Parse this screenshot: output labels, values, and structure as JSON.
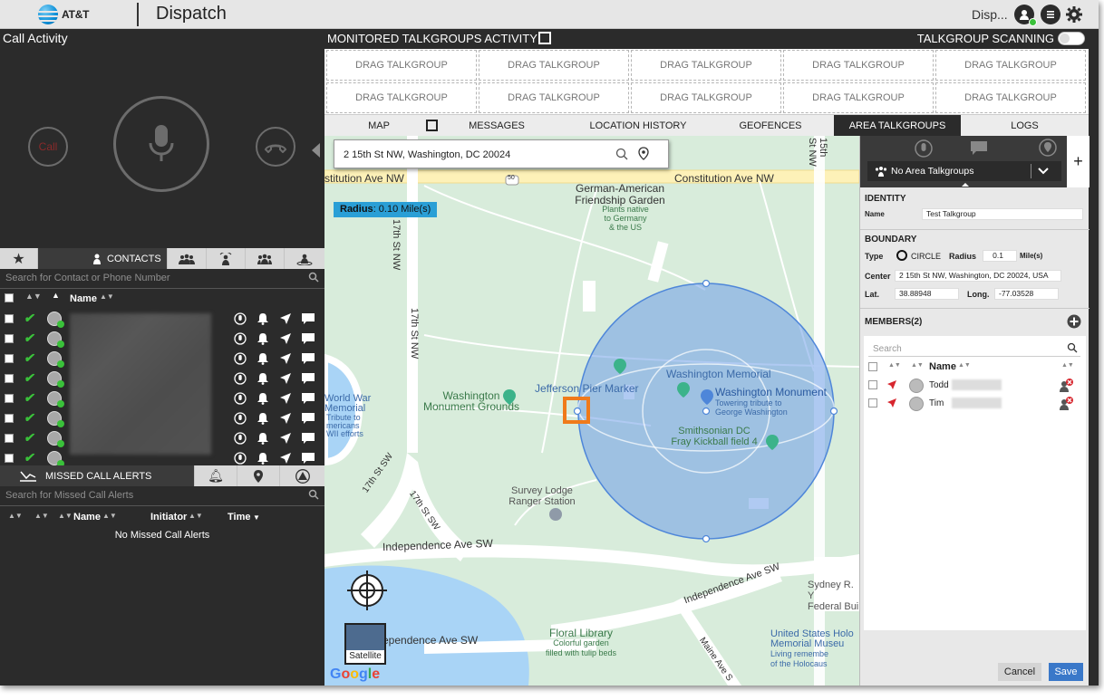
{
  "brand": {
    "logo_text": "AT&T",
    "app_title": "Dispatch",
    "user_label": "Disp..."
  },
  "call_activity": {
    "title": "Call Activity",
    "hold_label": "Call"
  },
  "contacts": {
    "tab_label": "CONTACTS",
    "search_placeholder": "Search for Contact or Phone Number",
    "column_name": "Name",
    "rows": [
      {
        "status": "online"
      },
      {
        "status": "online"
      },
      {
        "status": "online"
      },
      {
        "status": "online"
      },
      {
        "status": "online"
      },
      {
        "status": "online"
      },
      {
        "status": "online"
      },
      {
        "status": "online"
      }
    ]
  },
  "missed_alerts": {
    "tab_label": "MISSED CALL ALERTS",
    "search_placeholder": "Search for Missed Call Alerts",
    "col_name": "Name",
    "col_initiator": "Initiator",
    "col_time": "Time",
    "empty_text": "No Missed Call Alerts"
  },
  "monitored": {
    "title": "MONITORED TALKGROUPS ACTIVITY",
    "scanning_label": "TALKGROUP SCANNING",
    "scanning_on": false,
    "slots": [
      "DRAG TALKGROUP",
      "DRAG TALKGROUP",
      "DRAG TALKGROUP",
      "DRAG TALKGROUP",
      "DRAG TALKGROUP",
      "DRAG TALKGROUP",
      "DRAG TALKGROUP",
      "DRAG TALKGROUP",
      "DRAG TALKGROUP",
      "DRAG TALKGROUP"
    ]
  },
  "tabs": [
    "MAP",
    "MESSAGES",
    "LOCATION HISTORY",
    "GEOFENCES",
    "AREA TALKGROUPS",
    "LOGS"
  ],
  "active_tab": "AREA TALKGROUPS",
  "map": {
    "address": "2 15th St NW, Washington, DC 20024",
    "radius_label": "Radius",
    "radius_value": ": 0.10 Mile(s)",
    "satellite_label": "Satellite",
    "google_label": "Google",
    "labels": {
      "constitution": "Constitution Ave NW",
      "constitution_left": "stitution Ave NW",
      "german_garden": "German-American Friendship Garden",
      "german_sub1": "Plants native",
      "german_sub2": "to Germany",
      "german_sub3": "& the US",
      "jefferson": "Jefferson Pier Marker",
      "washington_memorial": "Washington Memorial",
      "washington_monument": "Washington Monument",
      "monument_sub1": "Towering tribute to",
      "monument_sub2": "George Washington",
      "monument_grounds1": "Washington",
      "monument_grounds2": "Monument Grounds",
      "ww_memorial1": "World War",
      "ww_memorial2": "Memorial",
      "ww_sub1": "Tribute to",
      "ww_sub2": "mericans",
      "ww_sub3": "WII efforts",
      "smithsonian1": "Smithsonian DC",
      "smithsonian2": "Fray Kickball field 4",
      "survey_lodge1": "Survey Lodge",
      "survey_lodge2": "Ranger Station",
      "independence": "Independence Ave SW",
      "independence_left": "ependence Ave SW",
      "independence_right": "Independence Ave SW",
      "floral1": "Floral Library",
      "floral2": "Colorful garden",
      "floral3": "filled with tulip beds",
      "sydney1": "Sydney R. Y",
      "sydney2": "Federal Bui",
      "usholo1": "United States Holo",
      "usholo2": "Memorial Museu",
      "usholo3": "Living remembe",
      "usholo4": "of the Holocaus",
      "maine": "Maine Ave S",
      "st17_top": "17th St NW",
      "st17_top2": "17th St NW",
      "st17_sw": "17th St SW",
      "st17_sw2": "17th St SW",
      "st15": "15th St NW",
      "ave_shield": "50"
    }
  },
  "area_talkgroup": {
    "dropdown_label": "No Area Talkgroups",
    "identity_header": "IDENTITY",
    "name_label": "Name",
    "name_value": "Test Talkgroup",
    "boundary_header": "BOUNDARY",
    "type_label": "Type",
    "type_value": "CIRCLE",
    "radius_label": "Radius",
    "radius_value": "0.1",
    "radius_unit": "Mile(s)",
    "center_label": "Center",
    "center_value": "2 15th St NW, Washington, DC 20024, USA",
    "lat_label": "Lat.",
    "lat_value": "38.88948",
    "long_label": "Long.",
    "long_value": "-77.03528",
    "members_header": "MEMBERS(2)",
    "members_search_placeholder": "Search",
    "members_col_name": "Name",
    "members": [
      {
        "name": "Todd"
      },
      {
        "name": "Tim"
      }
    ],
    "cancel_label": "Cancel",
    "save_label": "Save"
  },
  "colors": {
    "accent": "#2a9fd6",
    "online": "#3ac13a",
    "circle": "#6f9ee8",
    "save": "#3a78c9",
    "highlight": "#f07a1a"
  }
}
